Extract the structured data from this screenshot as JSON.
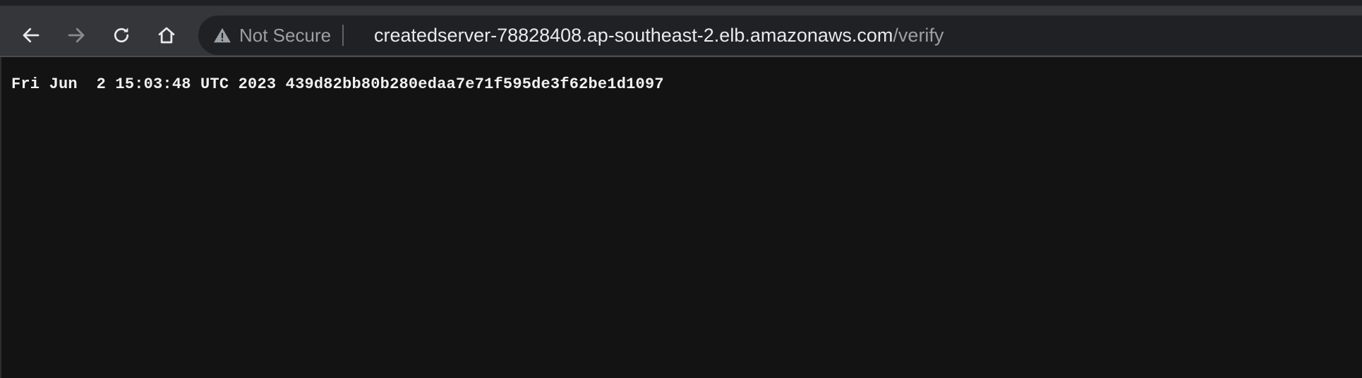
{
  "browser": {
    "toolbar": {
      "back_icon": "arrow-left-icon",
      "forward_icon": "arrow-right-icon",
      "reload_icon": "reload-icon",
      "home_icon": "home-icon"
    },
    "omnibox": {
      "security_icon": "warning-triangle-icon",
      "security_label": "Not Secure",
      "url_host": "createdserver-78828408.ap-southeast-2.elb.amazonaws.com",
      "url_path": "/verify"
    }
  },
  "page": {
    "body_text": "Fri Jun  2 15:03:48 UTC 2023 439d82bb80b280edaa7e71f595de3f62be1d1097"
  },
  "colors": {
    "toolbar_bg": "#35363a",
    "omnibox_bg": "#202124",
    "page_bg": "#131313",
    "text_primary": "#e8eaed",
    "text_muted": "#9aa0a6"
  }
}
